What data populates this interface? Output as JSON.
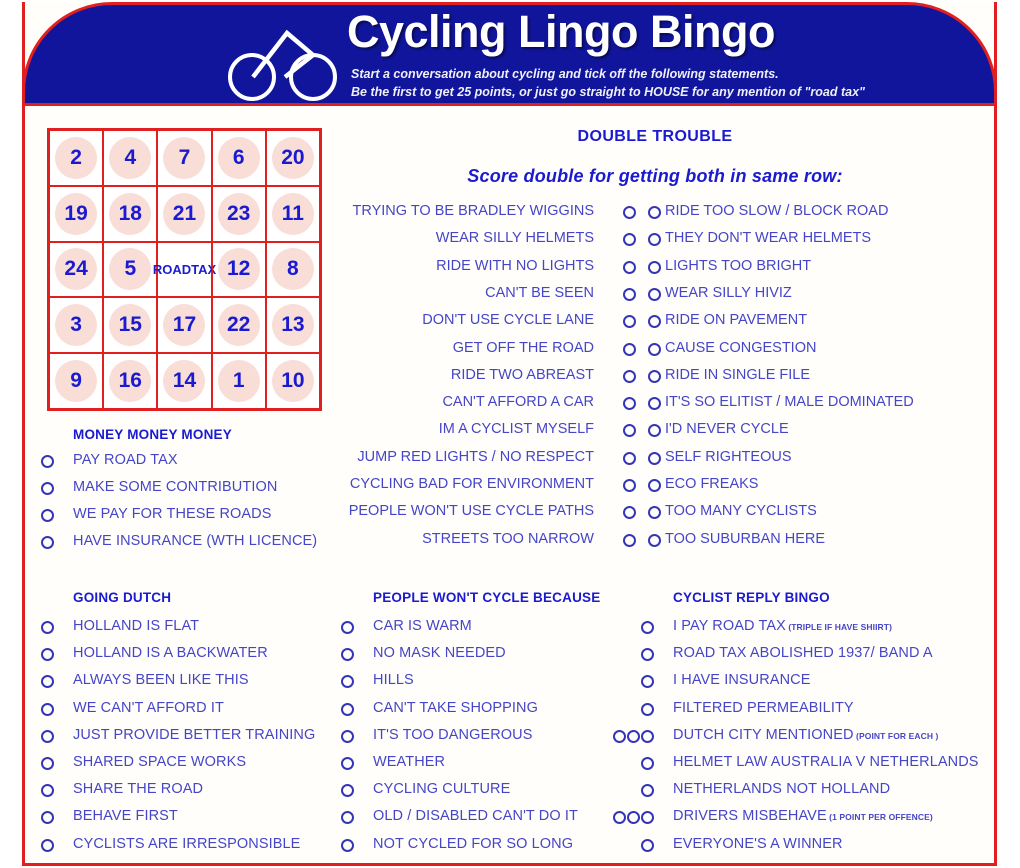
{
  "header": {
    "title": "Cycling Lingo Bingo",
    "subtitle_line1": "Start a conversation about cycling and tick off the following statements.",
    "subtitle_line2": "Be the first to get 25 points, or just go straight to HOUSE for any mention of \"road tax\"",
    "bike_icon": "bicycle-icon",
    "banner_color": "#10159c",
    "border_color": "#e02020"
  },
  "bingo_grid": {
    "rows": [
      [
        "2",
        "4",
        "7",
        "6",
        "20"
      ],
      [
        "19",
        "18",
        "21",
        "23",
        "11"
      ],
      [
        "24",
        "5",
        "ROAD\nTAX",
        "12",
        "8"
      ],
      [
        "3",
        "15",
        "17",
        "22",
        "13"
      ],
      [
        "9",
        "16",
        "14",
        "1",
        "10"
      ]
    ],
    "free_cell": {
      "row": 2,
      "col": 2,
      "line1": "ROAD",
      "line2": "TAX"
    },
    "disc_color": "#f9ddd7",
    "number_color": "#1a1ad0"
  },
  "double_trouble": {
    "title": "DOUBLE TROUBLE",
    "subtitle": "Score double for getting both in same row:",
    "pairs": [
      {
        "left": "TRYING TO BE BRADLEY WIGGINS",
        "right": "RIDE TOO SLOW / BLOCK ROAD"
      },
      {
        "left": "WEAR SILLY HELMETS",
        "right": "THEY DON'T WEAR HELMETS"
      },
      {
        "left": "RIDE WITH NO LIGHTS",
        "right": "LIGHTS TOO BRIGHT"
      },
      {
        "left": "CAN'T BE SEEN",
        "right": "WEAR SILLY HIVIZ"
      },
      {
        "left": "DON'T USE CYCLE LANE",
        "right": "RIDE ON PAVEMENT"
      },
      {
        "left": "GET OFF THE ROAD",
        "right": "CAUSE CONGESTION"
      },
      {
        "left": "RIDE TWO ABREAST",
        "right": "RIDE IN SINGLE FILE"
      },
      {
        "left": "CAN'T AFFORD A CAR",
        "right": "IT'S SO ELITIST / MALE DOMINATED"
      },
      {
        "left": "IM A CYCLIST MYSELF",
        "right": "I'D NEVER CYCLE"
      },
      {
        "left": "JUMP RED LIGHTS / NO RESPECT",
        "right": "SELF RIGHTEOUS"
      },
      {
        "left": "CYCLING BAD FOR ENVIRONMENT",
        "right": "ECO FREAKS"
      },
      {
        "left": "PEOPLE WON'T USE CYCLE PATHS",
        "right": "TOO MANY CYCLISTS"
      },
      {
        "left": "STREETS TOO NARROW",
        "right": "TOO SUBURBAN HERE"
      }
    ]
  },
  "money": {
    "heading": "MONEY MONEY MONEY",
    "items": [
      {
        "label": "PAY ROAD TAX",
        "bullets": 1
      },
      {
        "label": "MAKE SOME CONTRIBUTION",
        "bullets": 1
      },
      {
        "label": "WE PAY FOR THESE ROADS",
        "bullets": 1
      },
      {
        "label": "HAVE INSURANCE (WTH LICENCE)",
        "bullets": 1
      }
    ]
  },
  "going_dutch": {
    "heading": "GOING DUTCH",
    "items": [
      {
        "label": "HOLLAND IS FLAT",
        "bullets": 1
      },
      {
        "label": "HOLLAND IS A BACKWATER",
        "bullets": 1
      },
      {
        "label": "ALWAYS BEEN LIKE THIS",
        "bullets": 1
      },
      {
        "label": "WE CAN'T AFFORD IT",
        "bullets": 1
      },
      {
        "label": "JUST PROVIDE BETTER TRAINING",
        "bullets": 1
      },
      {
        "label": "SHARED SPACE WORKS",
        "bullets": 1
      },
      {
        "label": "SHARE THE ROAD",
        "bullets": 1
      },
      {
        "label": "BEHAVE FIRST",
        "bullets": 1
      },
      {
        "label": "CYCLISTS ARE IRRESPONSIBLE",
        "bullets": 1
      }
    ]
  },
  "wont_cycle": {
    "heading": "PEOPLE WON'T CYCLE BECAUSE",
    "items": [
      {
        "label": "CAR IS WARM",
        "bullets": 1
      },
      {
        "label": "NO MASK NEEDED",
        "bullets": 1
      },
      {
        "label": "HILLS",
        "bullets": 1
      },
      {
        "label": "CAN'T TAKE SHOPPING",
        "bullets": 1
      },
      {
        "label": "IT'S TOO DANGEROUS",
        "bullets": 3
      },
      {
        "label": "WEATHER",
        "bullets": 1
      },
      {
        "label": "CYCLING CULTURE",
        "bullets": 1
      },
      {
        "label": "OLD / DISABLED CAN'T DO IT",
        "bullets": 3
      },
      {
        "label": "NOT CYCLED FOR SO LONG",
        "bullets": 1
      }
    ]
  },
  "cyclist_reply": {
    "heading": "CYCLIST REPLY BINGO",
    "items": [
      {
        "label": "I PAY ROAD TAX",
        "note": "(TRIPLE IF HAVE SHIIRT)",
        "bullets": 1
      },
      {
        "label": "ROAD TAX ABOLISHED 1937/ BAND A",
        "note": "",
        "bullets": 1
      },
      {
        "label": "I HAVE INSURANCE",
        "note": "",
        "bullets": 1
      },
      {
        "label": "FILTERED PERMEABILITY",
        "note": "",
        "bullets": 1
      },
      {
        "label": "DUTCH CITY MENTIONED",
        "note": "(POINT FOR EACH )",
        "bullets": 3
      },
      {
        "label": "HELMET LAW AUSTRALIA V NETHERLANDS",
        "note": "",
        "bullets": 1
      },
      {
        "label": "NETHERLANDS NOT HOLLAND",
        "note": "",
        "bullets": 1
      },
      {
        "label": "DRIVERS MISBEHAVE",
        "note": "(1 POINT PER OFFENCE)",
        "bullets": 3
      },
      {
        "label": "EVERYONE'S A WINNER",
        "note": "",
        "bullets": 1
      }
    ]
  },
  "colors": {
    "blue": "#1a1ad0",
    "text_blue": "#4545c8",
    "red": "#e02020",
    "pink": "#f9ddd7",
    "navy": "#10159c"
  }
}
